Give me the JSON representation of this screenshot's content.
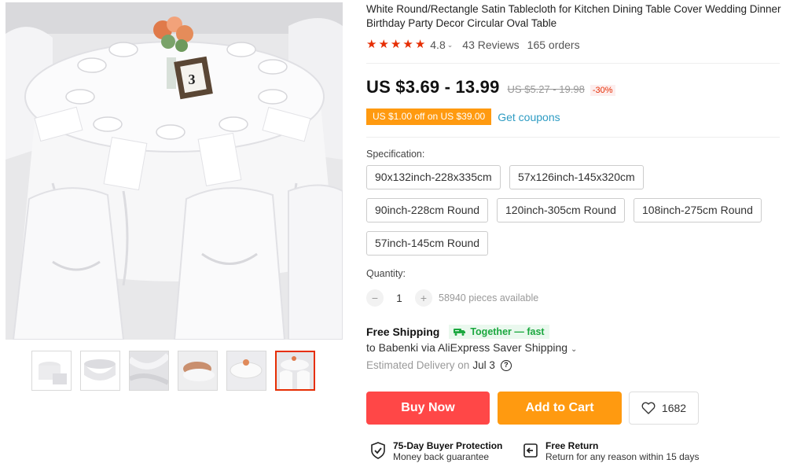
{
  "product": {
    "title": "White Round/Rectangle Satin Tablecloth for Kitchen Dining Table Cover Wedding Dinner Birthday Party Decor Circular Oval Table",
    "rating": "4.8",
    "reviews": "43 Reviews",
    "orders": "165 orders"
  },
  "gallery": {
    "table_number": "3",
    "thumb_count": 6,
    "active_thumb": 6
  },
  "price": {
    "current": "US $3.69 - 13.99",
    "original": "US $5.27 - 19.98",
    "discount": "-30%"
  },
  "coupon": {
    "label": "US $1.00 off on US $39.00",
    "link": "Get coupons"
  },
  "specification": {
    "label": "Specification:",
    "options": [
      "90x132inch-228x335cm",
      "57x126inch-145x320cm",
      "90inch-228cm Round",
      "120inch-305cm Round",
      "108inch-275cm Round",
      "57inch-145cm Round"
    ]
  },
  "quantity": {
    "label": "Quantity:",
    "value": "1",
    "minus": "−",
    "plus": "+",
    "available": "58940 pieces available"
  },
  "shipping": {
    "title": "Free Shipping",
    "tag": "Together — fast",
    "to": "to Babenki via AliExpress Saver Shipping",
    "delivery_label": "Estimated Delivery on",
    "delivery_date": "Jul 3"
  },
  "actions": {
    "buy": "Buy Now",
    "cart": "Add to Cart",
    "wishlist_count": "1682"
  },
  "guarantees": [
    {
      "title": "75-Day Buyer Protection",
      "subtitle": "Money back guarantee"
    },
    {
      "title": "Free Return",
      "subtitle": "Return for any reason within 15 days"
    }
  ],
  "colors": {
    "accent_red": "#ff4747",
    "star_red": "#e62e04",
    "orange": "#ff9a10",
    "link_blue": "#2e9cc3",
    "green": "#1ba83f"
  }
}
